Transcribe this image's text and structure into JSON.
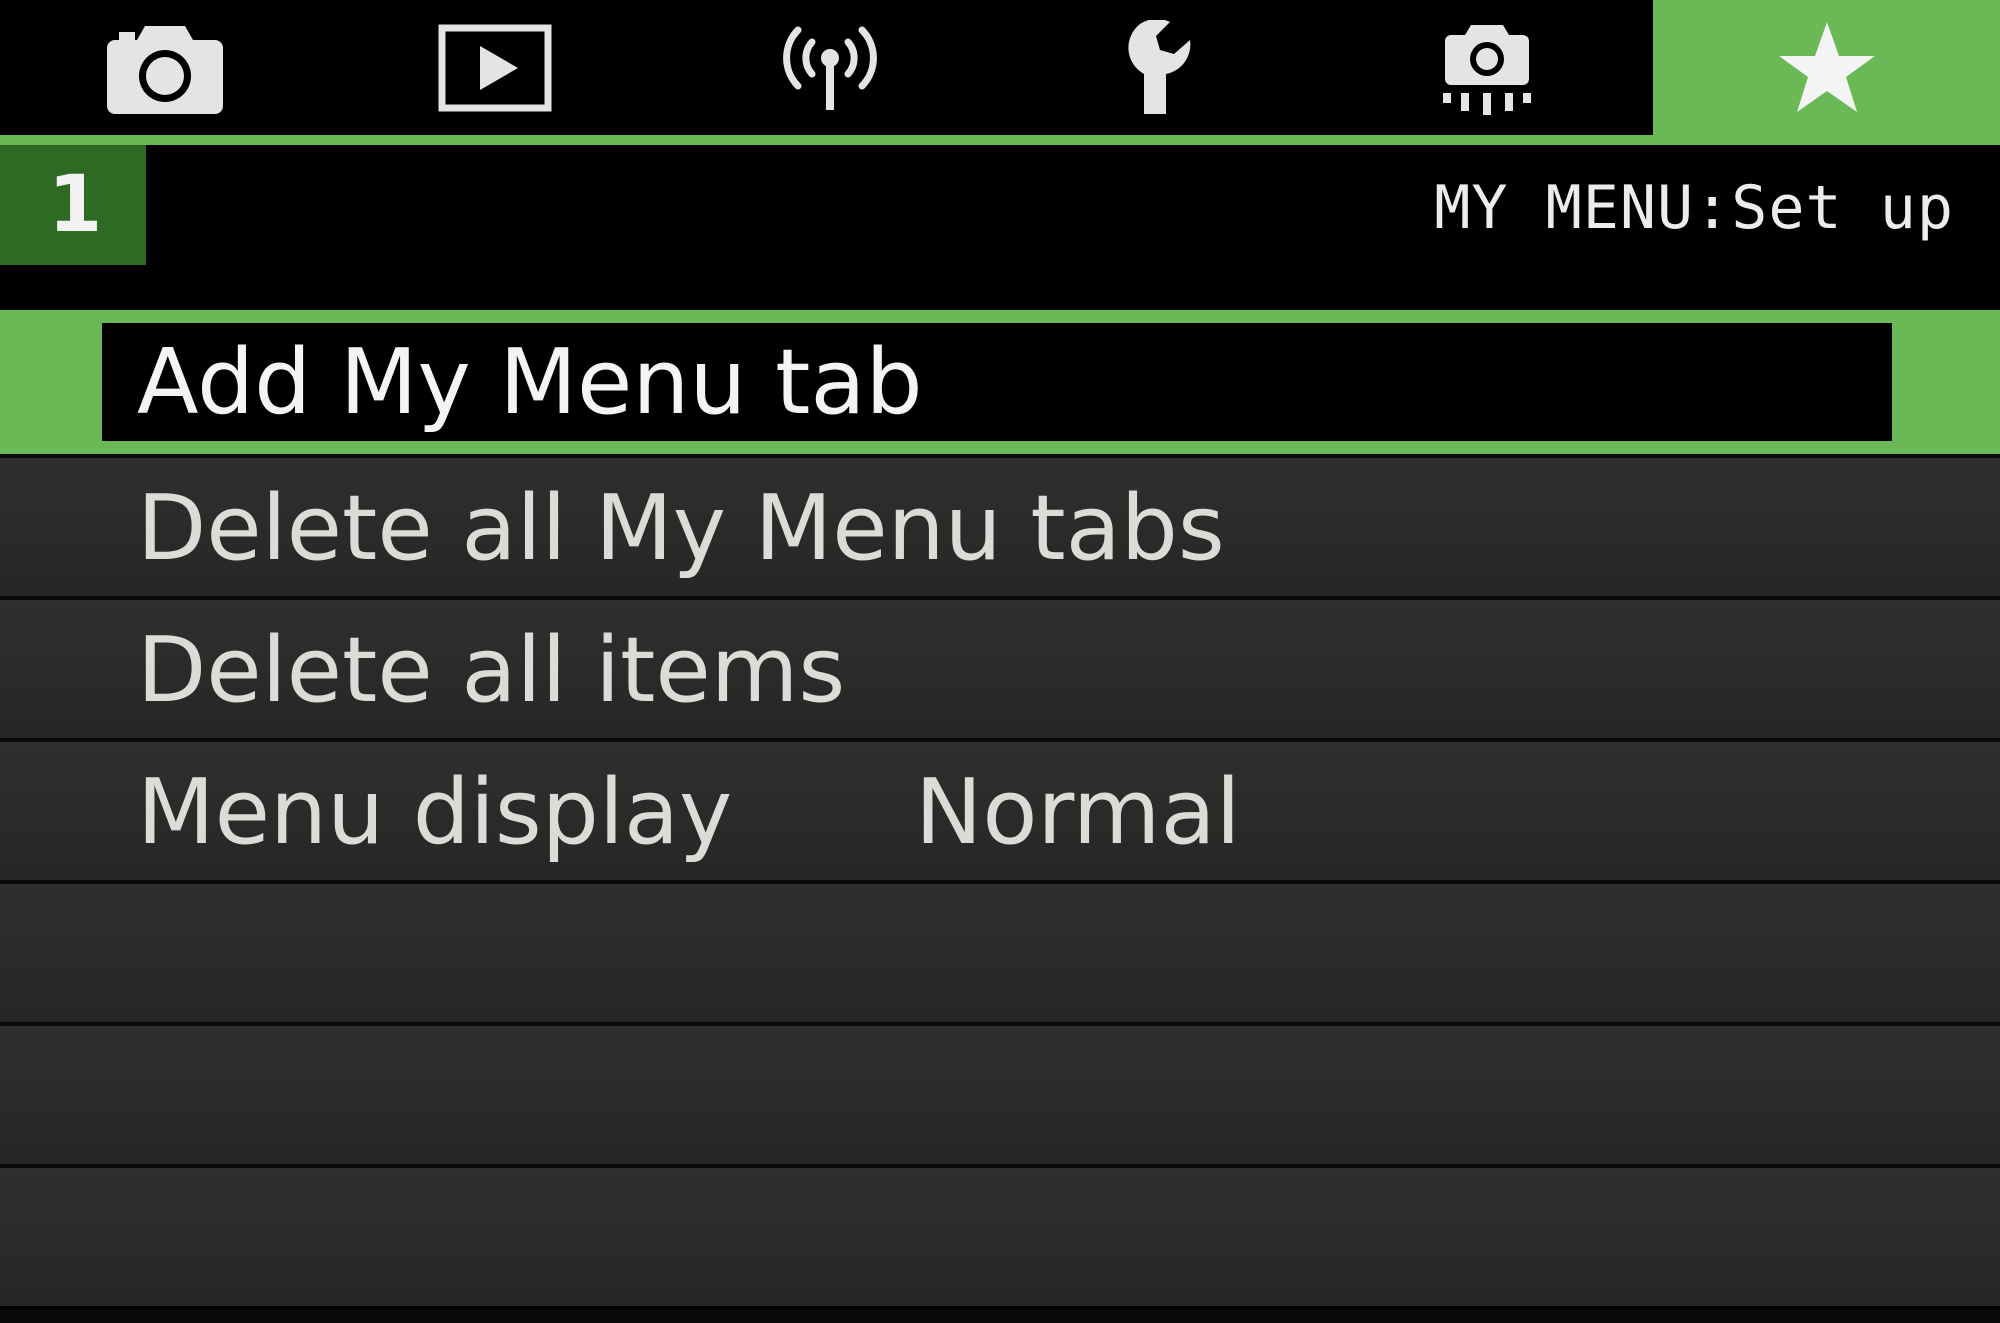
{
  "colors": {
    "accent": "#6ab956",
    "subtab": "#2e6a24",
    "background": "#000000",
    "row": "#2b2b2b",
    "text": "#dcdcd6"
  },
  "tabs": [
    {
      "icon": "camera-icon",
      "active": false
    },
    {
      "icon": "playback-icon",
      "active": false
    },
    {
      "icon": "wireless-icon",
      "active": false
    },
    {
      "icon": "wrench-icon",
      "active": false
    },
    {
      "icon": "custom-function-camera-icon",
      "active": false
    },
    {
      "icon": "star-icon",
      "active": true
    }
  ],
  "subheader": {
    "tab_number": "1",
    "title": "MY MENU:Set up"
  },
  "menu": {
    "items": [
      {
        "label": "Add My Menu tab",
        "value": "",
        "selected": true
      },
      {
        "label": "Delete all My Menu tabs",
        "value": "",
        "selected": false
      },
      {
        "label": "Delete all items",
        "value": "",
        "selected": false
      },
      {
        "label": "Menu display",
        "value": "Normal",
        "selected": false
      }
    ]
  }
}
